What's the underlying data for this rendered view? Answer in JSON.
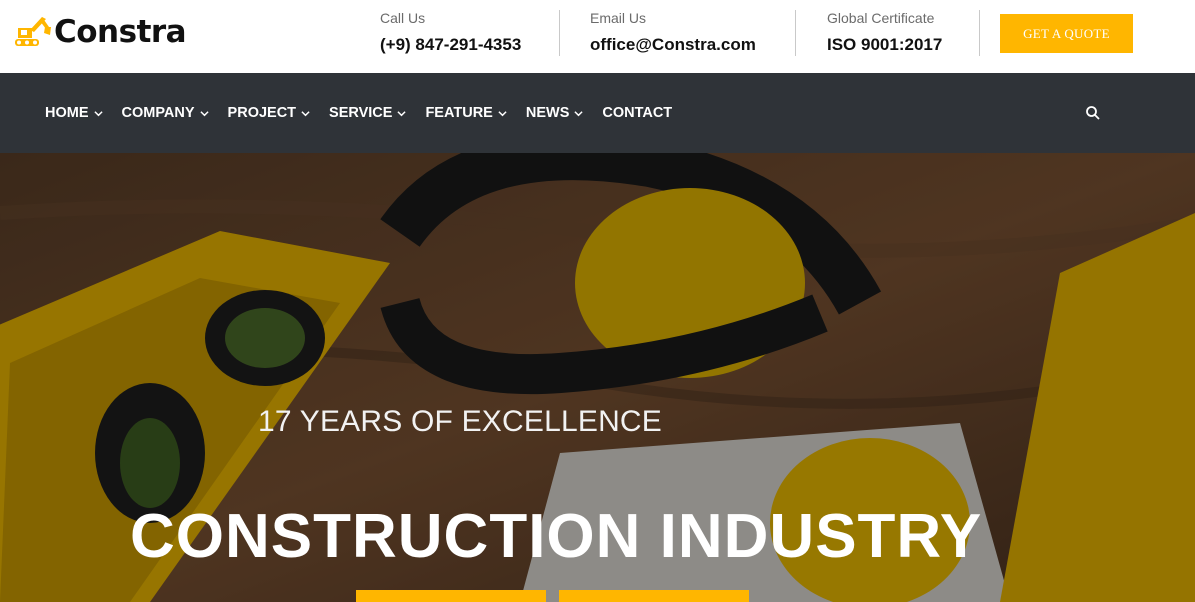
{
  "brand": {
    "name": "Constra",
    "logo_icon": "excavator-icon",
    "accent": "#ffb600"
  },
  "contact": {
    "call": {
      "label": "Call Us",
      "value": "(+9) 847-291-4353"
    },
    "email": {
      "label": "Email Us",
      "value": "office@Constra.com"
    },
    "certificate": {
      "label": "Global Certificate",
      "value": "ISO 9001:2017"
    }
  },
  "quote_button": "GET A QUOTE",
  "nav": {
    "items": [
      {
        "label": "HOME",
        "has_dropdown": true
      },
      {
        "label": "COMPANY",
        "has_dropdown": true
      },
      {
        "label": "PROJECT",
        "has_dropdown": true
      },
      {
        "label": "SERVICE",
        "has_dropdown": true
      },
      {
        "label": "FEATURE",
        "has_dropdown": true
      },
      {
        "label": "NEWS",
        "has_dropdown": true
      },
      {
        "label": "CONTACT",
        "has_dropdown": false
      }
    ],
    "search_icon": "search-icon",
    "background": "#2f3338"
  },
  "hero": {
    "subtitle": "17 YEARS OF EXCELLENCE",
    "title": "CONSTRUCTION INDUSTRY"
  }
}
